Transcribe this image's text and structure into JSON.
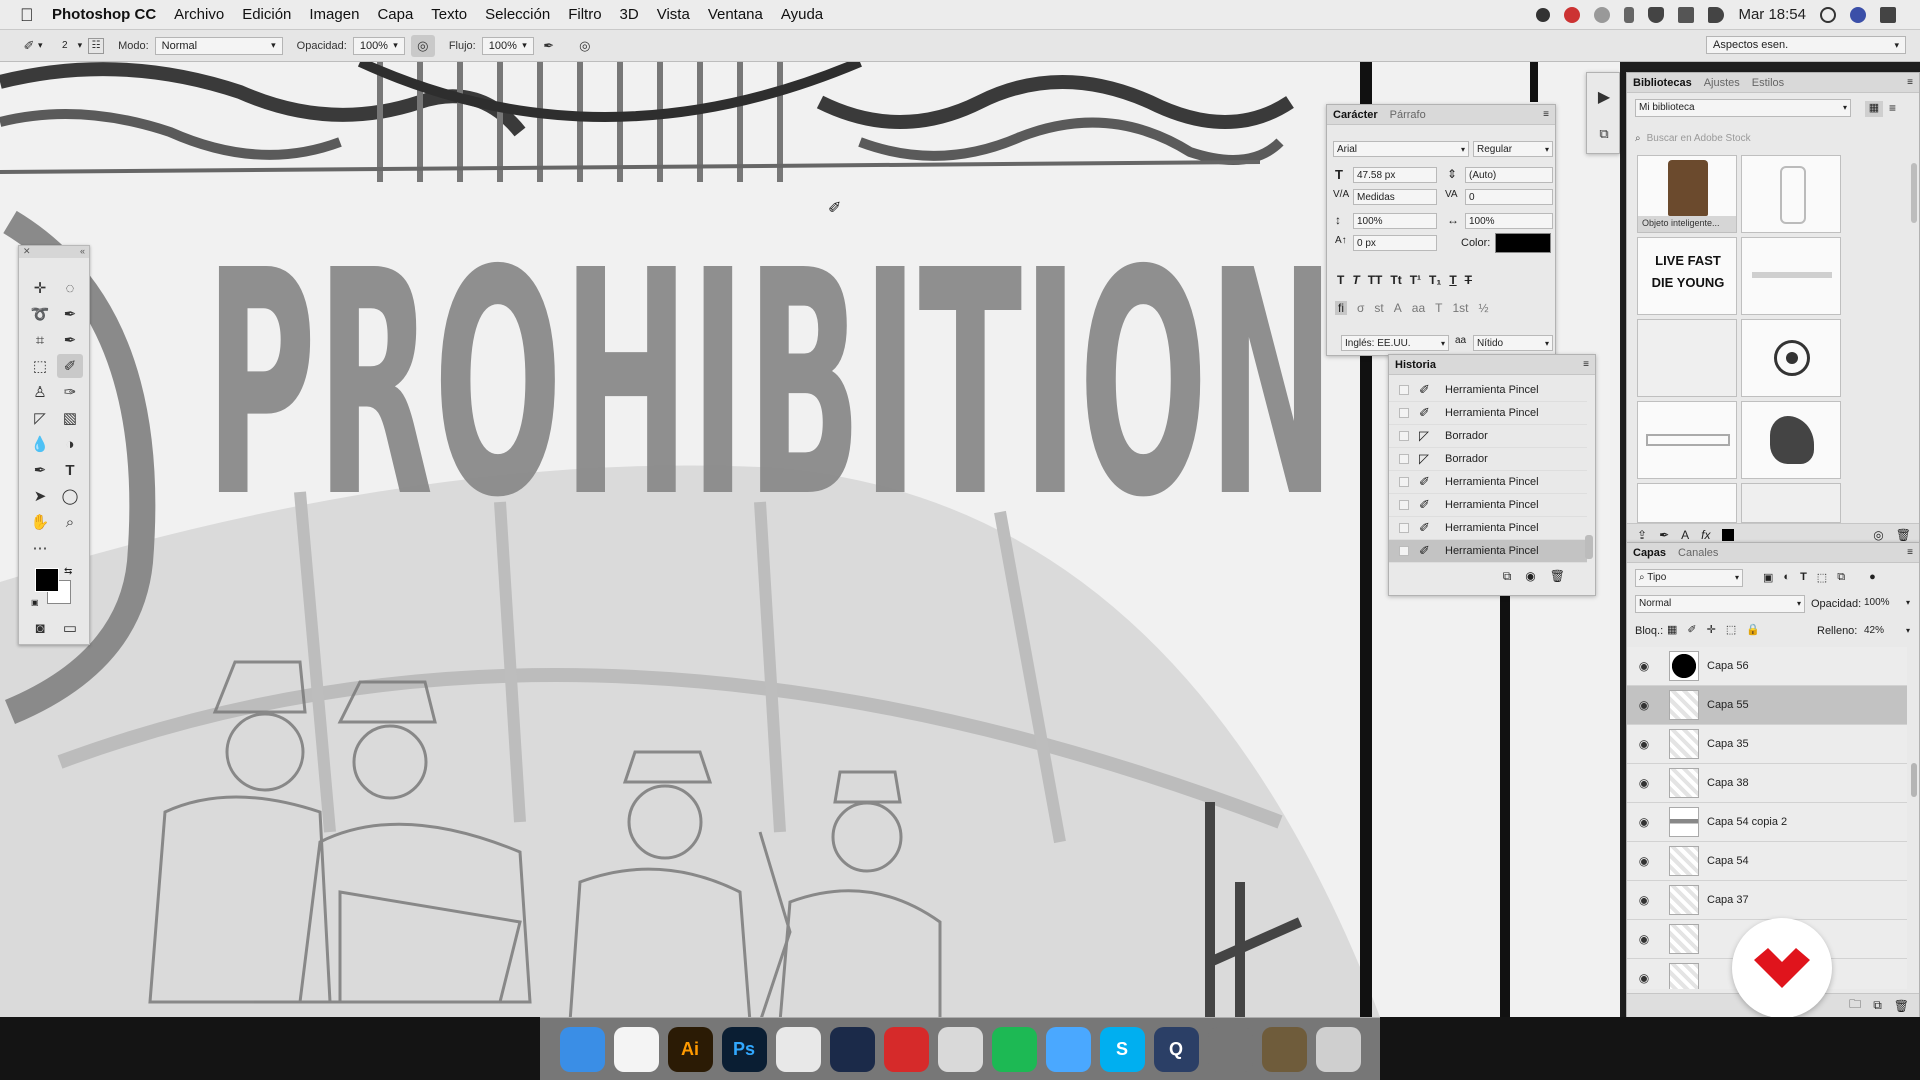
{
  "menubar": {
    "items": [
      "Photoshop CC",
      "Archivo",
      "Edición",
      "Imagen",
      "Capa",
      "Texto",
      "Selección",
      "Filtro",
      "3D",
      "Vista",
      "Ventana",
      "Ayuda"
    ],
    "clock": "Mar 18:54"
  },
  "options_bar": {
    "brush_size": "2",
    "mode_label": "Modo:",
    "mode_value": "Normal",
    "opacity_label": "Opacidad:",
    "opacity_value": "100%",
    "flow_label": "Flujo:",
    "flow_value": "100%",
    "workspace": "Aspectos esen."
  },
  "canvas": {
    "title_text": "PROHIBITION"
  },
  "character_panel": {
    "tabs": [
      "Carácter",
      "Párrafo"
    ],
    "font_family": "Arial",
    "font_style": "Regular",
    "font_size": "47.58 px",
    "leading": "(Auto)",
    "kerning": "Medidas",
    "tracking": "0",
    "vertical_scale": "100%",
    "horizontal_scale": "100%",
    "baseline_shift": "0 px",
    "color_label": "Color:",
    "language": "Inglés: EE.UU.",
    "antialias": "Nítido",
    "aa_icon": "aa"
  },
  "history_panel": {
    "title": "Historia",
    "items": [
      {
        "label": "Herramienta Pincel",
        "icon": "brush"
      },
      {
        "label": "Herramienta Pincel",
        "icon": "brush"
      },
      {
        "label": "Borrador",
        "icon": "eraser"
      },
      {
        "label": "Borrador",
        "icon": "eraser"
      },
      {
        "label": "Herramienta Pincel",
        "icon": "brush"
      },
      {
        "label": "Herramienta Pincel",
        "icon": "brush"
      },
      {
        "label": "Herramienta Pincel",
        "icon": "brush"
      },
      {
        "label": "Herramienta Pincel",
        "icon": "brush"
      }
    ]
  },
  "libraries_panel": {
    "tabs": [
      "Bibliotecas",
      "Ajustes",
      "Estilos"
    ],
    "library_name": "Mi biblioteca",
    "search_placeholder": "Buscar en Adobe Stock",
    "first_item_caption": "Objeto inteligente...",
    "thumb_texts": [
      "LIVE FAST",
      "DIE YOUNG"
    ]
  },
  "layers_panel": {
    "tabs": [
      "Capas",
      "Canales"
    ],
    "filter_label": "Tipo",
    "blend_mode": "Normal",
    "opacity_label": "Opacidad:",
    "opacity_value": "100%",
    "lock_label": "Bloq.:",
    "fill_label": "Relleno:",
    "fill_value": "42%",
    "layers": [
      "Capa 56",
      "Capa 55",
      "Capa 35",
      "Capa 38",
      "Capa 54 copia 2",
      "Capa 54",
      "Capa 37",
      "",
      ""
    ]
  },
  "dock": {
    "apps": [
      {
        "name": "finder",
        "label": "",
        "color": "#3a8ee6"
      },
      {
        "name": "itunes",
        "label": "",
        "color": "#f4f4f4"
      },
      {
        "name": "illustrator",
        "label": "Ai",
        "color": "#2b1b05"
      },
      {
        "name": "photoshop",
        "label": "Ps",
        "color": "#0a1e33"
      },
      {
        "name": "chrome",
        "label": "",
        "color": "#e8e8e8"
      },
      {
        "name": "cinema4d",
        "label": "",
        "color": "#1b2a49"
      },
      {
        "name": "sketchup",
        "label": "",
        "color": "#d62a2a"
      },
      {
        "name": "zbrush",
        "label": "",
        "color": "#d9d9d9"
      },
      {
        "name": "spotify",
        "label": "",
        "color": "#1db954"
      },
      {
        "name": "messages",
        "label": "",
        "color": "#4aa8ff"
      },
      {
        "name": "skype",
        "label": "S",
        "color": "#00aff0"
      },
      {
        "name": "quicktime",
        "label": "Q",
        "color": "#2b3f66"
      },
      {
        "name": "system-preferences",
        "label": "",
        "color": "#777"
      },
      {
        "name": "document",
        "label": "",
        "color": "#6f5c3b"
      },
      {
        "name": "trash",
        "label": "",
        "color": "#cfcfcf"
      }
    ]
  }
}
